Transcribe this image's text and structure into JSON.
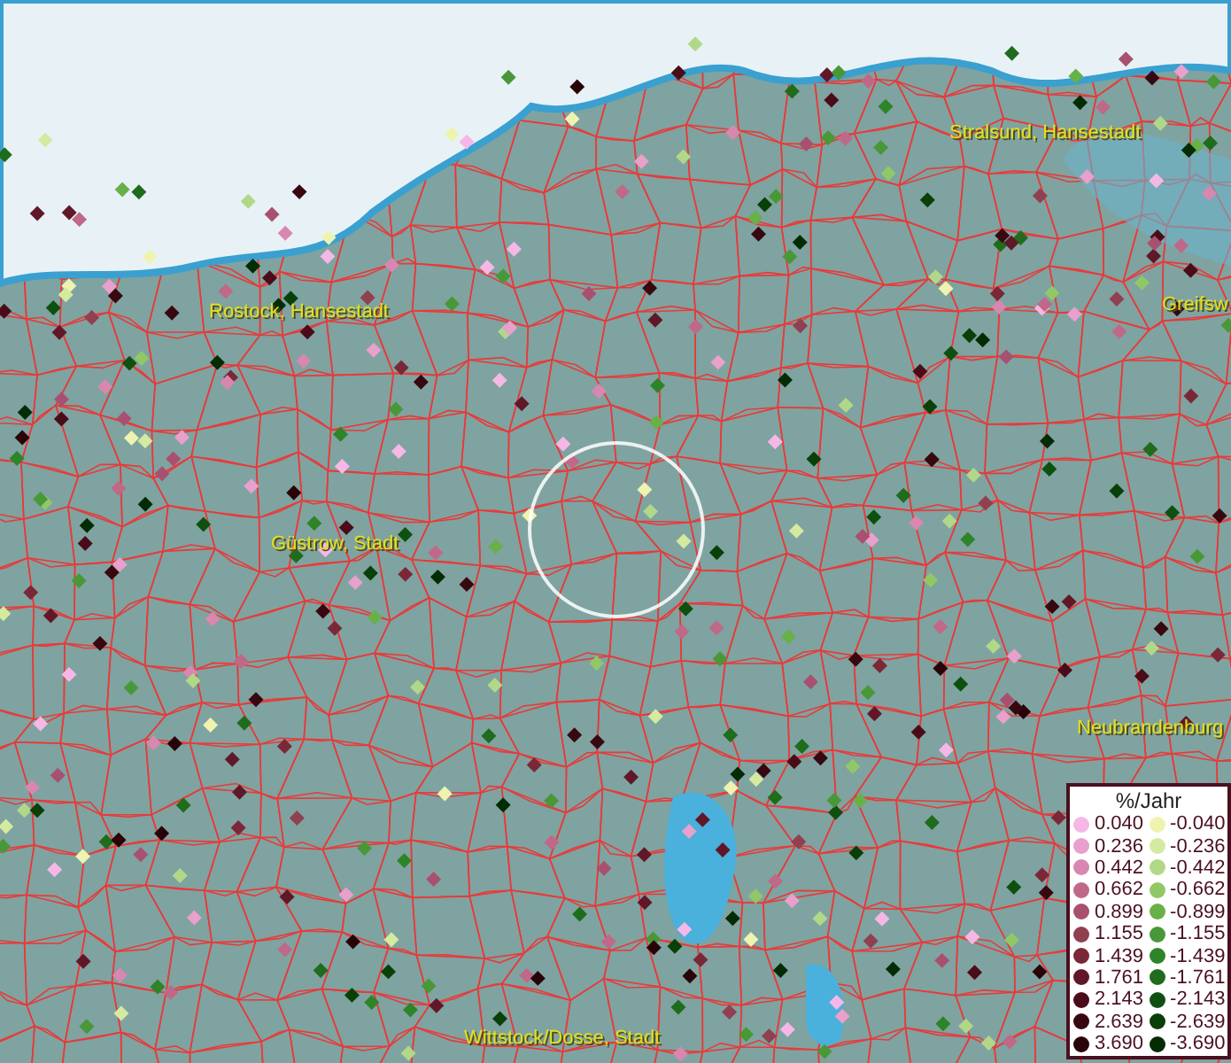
{
  "places": [
    {
      "name": "Rostock, Hansestadt"
    },
    {
      "name": "Stralsund, Hansestadt"
    },
    {
      "name": "Greifsw"
    },
    {
      "name": "Güstrow, Stadt"
    },
    {
      "name": "Neubrandenburg"
    },
    {
      "name": "Wittstock/Dosse, Stadt"
    }
  ],
  "legend": {
    "title": "%/Jahr",
    "positive": [
      {
        "value": "0.040",
        "color": "#f5b8e6"
      },
      {
        "value": "0.236",
        "color": "#e8a0cc"
      },
      {
        "value": "0.442",
        "color": "#d888b0"
      },
      {
        "value": "0.662",
        "color": "#c06888"
      },
      {
        "value": "0.899",
        "color": "#a85070"
      },
      {
        "value": "1.155",
        "color": "#904050"
      },
      {
        "value": "1.439",
        "color": "#7a2838"
      },
      {
        "value": "1.761",
        "color": "#601828"
      },
      {
        "value": "2.143",
        "color": "#4a0c18"
      },
      {
        "value": "2.639",
        "color": "#380810"
      },
      {
        "value": "3.690",
        "color": "#280408"
      }
    ],
    "negative": [
      {
        "value": "-0.040",
        "color": "#eef4b0"
      },
      {
        "value": "-0.236",
        "color": "#d4eaa0"
      },
      {
        "value": "-0.442",
        "color": "#b0d888"
      },
      {
        "value": "-0.662",
        "color": "#90c868"
      },
      {
        "value": "-0.899",
        "color": "#68b048"
      },
      {
        "value": "-1.155",
        "color": "#489838"
      },
      {
        "value": "-1.439",
        "color": "#2e8428"
      },
      {
        "value": "-1.761",
        "color": "#1e6c1c"
      },
      {
        "value": "-2.143",
        "color": "#0e5010"
      },
      {
        "value": "-2.639",
        "color": "#084008"
      },
      {
        "value": "-3.690",
        "color": "#042c04"
      }
    ]
  }
}
